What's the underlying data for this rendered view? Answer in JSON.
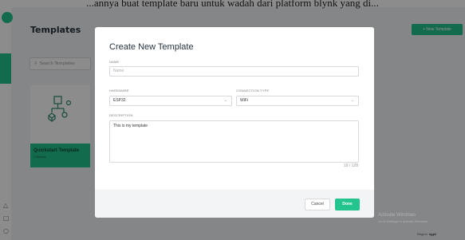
{
  "caption": "...annya buat template baru untuk wadah dari platform blynk yang di...",
  "page": {
    "title": "Templates",
    "new_template_label": "+ New Template",
    "search_placeholder": "Search Templates"
  },
  "card": {
    "title": "Quickstart Template",
    "subtitle": "1 Device"
  },
  "dialog": {
    "title": "Create New Template",
    "name_label": "NAME",
    "name_placeholder": "Name",
    "hardware_label": "HARDWARE",
    "hardware_value": "ESP32",
    "connection_label": "CONNECTION TYPE",
    "connection_value": "WiFi",
    "description_label": "DESCRIPTION",
    "description_value": "This is my template",
    "char_counter": "19 / 128",
    "cancel_label": "Cancel",
    "done_label": "Done"
  },
  "watermark": {
    "line1": "Activate Windows",
    "line2": "Go to Settings to activate Windows."
  },
  "footer": {
    "region_label": "Region:",
    "region_value": "sgp1",
    "privacy": "Privacy"
  },
  "colors": {
    "accent": "#23c48e",
    "dark_text": "#26343f"
  }
}
